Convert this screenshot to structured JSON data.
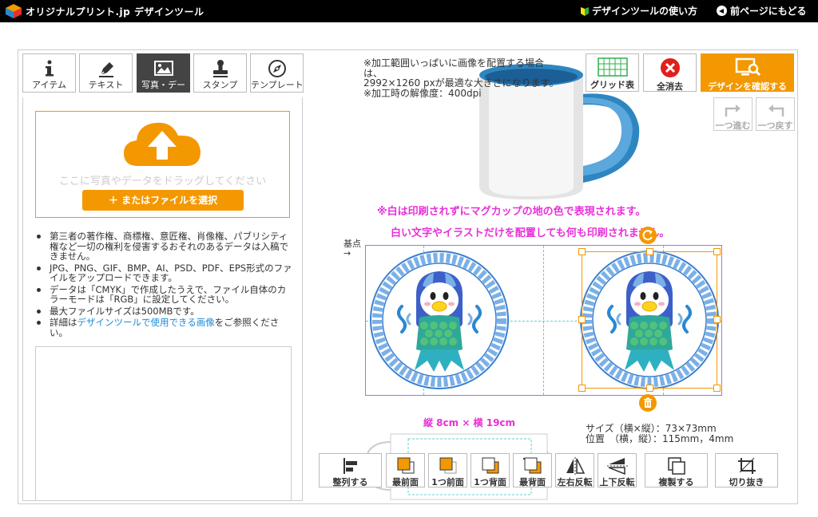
{
  "header": {
    "brand": "オリジナルプリント.jp デザインツール",
    "howto_link": "デザインツールの使い方",
    "back_link": "前ページにもどる"
  },
  "tabs": [
    {
      "label": "アイテム",
      "icon": "info-icon"
    },
    {
      "label": "テキスト",
      "icon": "pen-icon"
    },
    {
      "label": "写真・デー",
      "icon": "image-icon",
      "active": true
    },
    {
      "label": "スタンプ",
      "icon": "stamp-icon"
    },
    {
      "label": "テンプレート",
      "icon": "compass-icon"
    }
  ],
  "upload": {
    "drop_text": "ここに写真やデータをドラッグしてください",
    "file_button": "＋ またはファイルを選択"
  },
  "notes": [
    "第三者の著作権、商標権、意匠権、肖像権、パブリシティ権など一切の権利を侵害するおそれのあるデータは入稿できません。",
    "JPG、PNG、GIF、BMP、AI、PSD、PDF、EPS形式のファイルをアップロードできます。",
    "データは「CMYK」で作成したうえで、ファイル自体のカラーモードは「RGB」に設定してください。",
    "最大ファイルサイズは500MBです。"
  ],
  "notes_link": {
    "prefix": "詳細は",
    "link": "デザインツールで使用できる画像",
    "suffix": "をご参照ください。"
  },
  "hint": {
    "line1": "※加工範囲いっぱいに画像を配置する場合は、",
    "line2": "2992×1260 pxが最適な大きさになります。",
    "line3": "※加工時の解像度：400dpi"
  },
  "toolbar": {
    "grid": "グリッド表示",
    "clear": "全消去",
    "confirm": "デザインを確認する",
    "redo": "一つ進む",
    "undo": "一つ戻す"
  },
  "warning": {
    "line1": "※白は印刷されずにマグカップの地の色で表現されます。",
    "line2": "白い文字やイラストだけを配置しても何も印刷されません。"
  },
  "canvas": {
    "base_point": "基点",
    "size_label": "縦 8cm × 横 19cm"
  },
  "object_info": {
    "size": "サイズ（横×縦）：73×73mm",
    "position": "位置　（横，縦）：115mm，4mm"
  },
  "bottom_toolbar": [
    {
      "label": "整列する",
      "icon": "align-icon"
    },
    {
      "label": "最前面",
      "icon": "bring-front-icon"
    },
    {
      "label": "1つ前面",
      "icon": "bring-forward-icon"
    },
    {
      "label": "1つ背面",
      "icon": "send-backward-icon"
    },
    {
      "label": "最背面",
      "icon": "send-back-icon"
    },
    {
      "label": "左右反転",
      "icon": "flip-h-icon"
    },
    {
      "label": "上下反転",
      "icon": "flip-v-icon"
    },
    {
      "label": "複製する",
      "icon": "duplicate-icon"
    },
    {
      "label": "切り抜き",
      "icon": "crop-icon"
    }
  ],
  "colors": {
    "accent": "#f39800",
    "warning": "#e830d8",
    "link": "#1a8cd8",
    "header": "#000000"
  }
}
